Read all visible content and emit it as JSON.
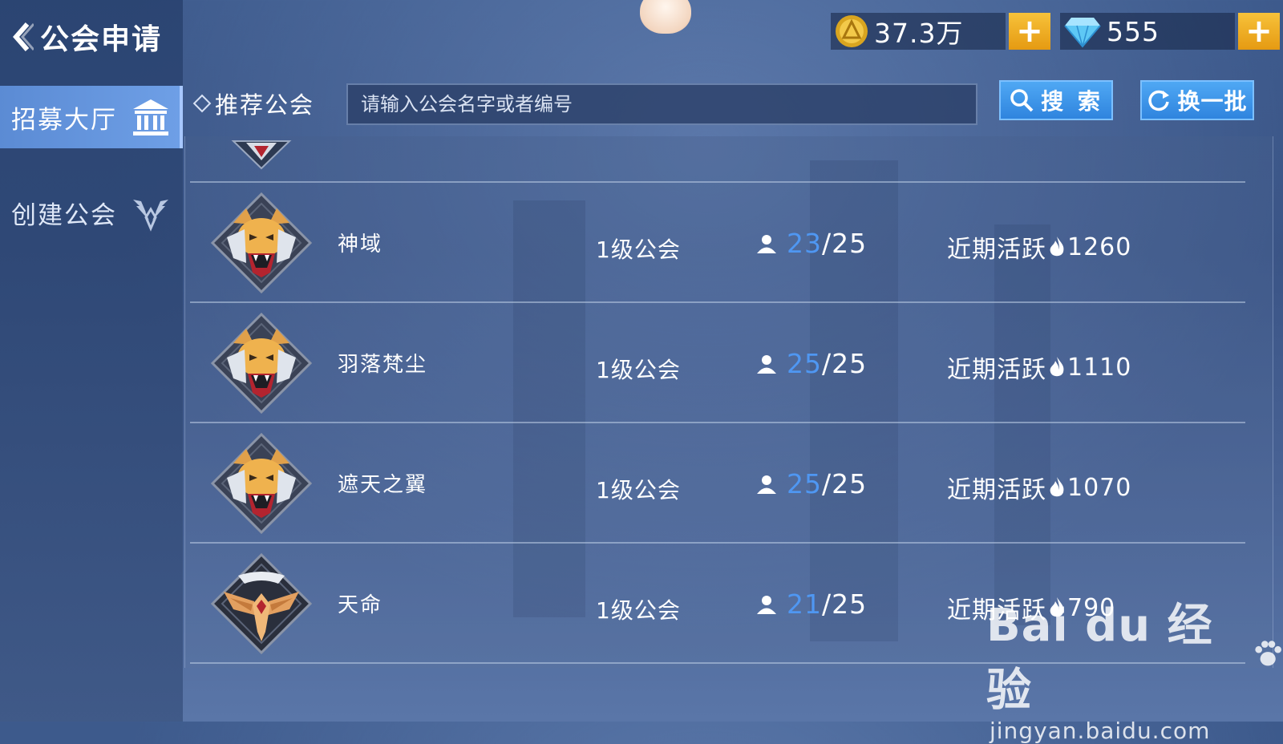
{
  "header": {
    "title": "公会申请",
    "back_icon": "chevron-left-icon"
  },
  "sidebar": {
    "items": [
      {
        "label": "招募大厅",
        "icon": "hall-icon",
        "active": true
      },
      {
        "label": "创建公会",
        "icon": "wings-icon",
        "active": false
      }
    ]
  },
  "resources": {
    "gold": {
      "value": "37.3万",
      "icon": "gold-coin-icon",
      "plus_label": "+"
    },
    "gems": {
      "value": "555",
      "icon": "diamond-icon",
      "plus_label": "+"
    }
  },
  "search": {
    "section_label": "推荐公会",
    "placeholder": "请输入公会名字或者编号",
    "value": "",
    "search_label": "搜 索",
    "refresh_label": "换一批"
  },
  "guilds": [
    {
      "name": "神域",
      "level": "1级公会",
      "members": "23",
      "capacity": "/25",
      "activity_label": "近期活跃",
      "activity": "1260",
      "emblem": "tiger-emblem-icon"
    },
    {
      "name": "羽落梵尘",
      "level": "1级公会",
      "members": "25",
      "capacity": "/25",
      "activity_label": "近期活跃",
      "activity": "1110",
      "emblem": "tiger-emblem-icon"
    },
    {
      "name": "遮天之翼",
      "level": "1级公会",
      "members": "25",
      "capacity": "/25",
      "activity_label": "近期活跃",
      "activity": "1070",
      "emblem": "tiger-emblem-icon"
    },
    {
      "name": "天命",
      "level": "1级公会",
      "members": "21",
      "capacity": "/25",
      "activity_label": "近期活跃",
      "activity": "790",
      "emblem": "eagle-emblem-icon"
    }
  ],
  "watermark": {
    "brand": "Bai du 经验",
    "url": "jingyan.baidu.com"
  },
  "colors": {
    "member_count": "#4f97f2",
    "active_tab": "#6e9fe6",
    "plus_button": "#f0b020",
    "action_button": "#3a94e8"
  }
}
